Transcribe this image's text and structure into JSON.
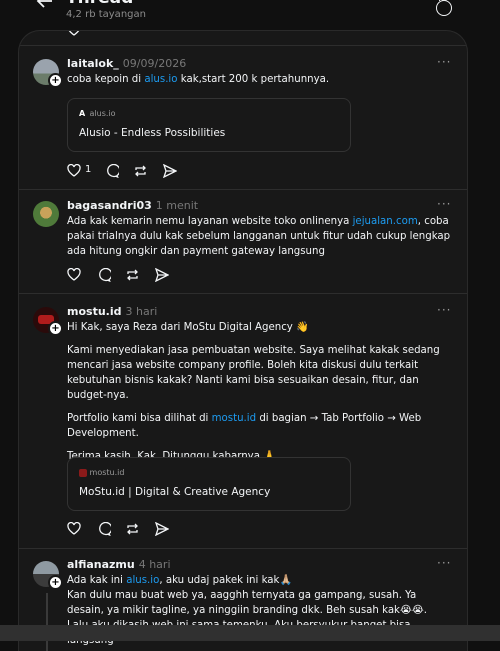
{
  "header": {
    "title": "Thread",
    "views": "4,2 rb tayangan"
  },
  "posts": [
    {
      "username": "laitalok_",
      "time": "09/09/2026",
      "text_pre": "coba kepoin di ",
      "link": "alus.io",
      "text_post": " kak,start 200 k pertahunnya.",
      "card": {
        "domain": "alus.io",
        "title": "Alusio - Endless Possibilities"
      },
      "likes": "1"
    },
    {
      "username": "bagasandri03",
      "time": "1 menit",
      "text_pre": "Ada kak kemarin nemu layanan website toko onlinenya ",
      "link": "jejualan.com",
      "text_post": ", coba pakai trialnya dulu kak sebelum langganan untuk fitur udah cukup lengkap ada hitung ongkir dan payment gateway langsung"
    },
    {
      "username": "mostu.id",
      "time": "3 hari",
      "p1": "Hi Kak, saya Reza dari MoStu Digital Agency 👋",
      "p2": "Kami menyediakan jasa pembuatan website. Saya melihat kakak sedang mencari jasa website company profile. Boleh kita diskusi dulu terkait kebutuhan bisnis kakak? Nanti kami bisa sesuaikan desain, fitur, dan budget-nya.",
      "p3_pre": "Portfolio kami bisa dilihat di ",
      "link": "mostu.id",
      "p3_post": " di bagian → Tab Portfolio → Web Development.",
      "p4": "Terima kasih, Kak. Ditunggu kabarnya 🙏",
      "card": {
        "domain": "mostu.id",
        "title": "MoStu.id | Digital & Creative Agency"
      }
    },
    {
      "username": "alfianazmu",
      "time": "4 hari",
      "line1_pre": "Ada kak ini ",
      "link": "alus.io",
      "line1_post": ", aku udaj pakek ini kak🙏🏼",
      "line2": "Kan dulu mau buat web ya, aagghh ternyata ga gampang, susah. Ya desain, ya mikir tagline, ya ninggiin branding dkk. Beh susah kak😭😭.",
      "line3": "Lalu aku dikasih web ini sama temenku. Aku bersyukur banget bisa langsung"
    }
  ],
  "more_label": "···",
  "colors": {
    "link": "#1d9bf0",
    "bg": "#101010",
    "panel": "#181818"
  }
}
